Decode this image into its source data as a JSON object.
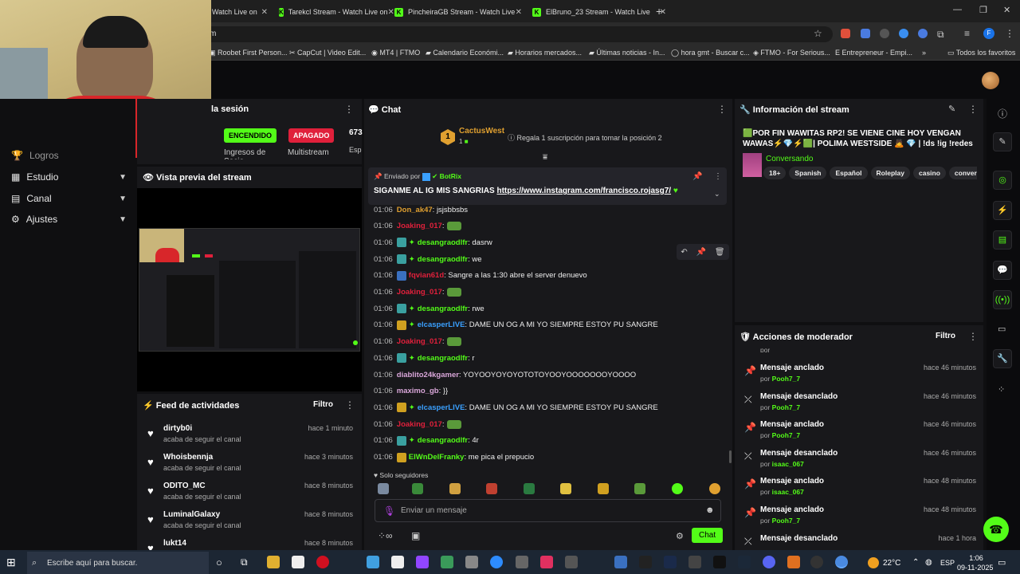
{
  "browser": {
    "tabs": [
      {
        "label": "Watch Live on"
      },
      {
        "label": "Tarekcl Stream - Watch Live on"
      },
      {
        "label": "PincheiraGB Stream - Watch Live"
      },
      {
        "label": "ElBruno_23 Stream - Watch Live"
      }
    ],
    "url": "m",
    "bookmarks": [
      "Roobet First Person...",
      "CapCut | Video Edit...",
      "MT4 | FTMO",
      "Calendario Económi...",
      "Horarios mercados...",
      "Últimas noticias - In...",
      "hora gmt - Buscar c...",
      "FTMO - For Serious...",
      "Entrepreneur - Empi...",
      "Todos los favoritos"
    ]
  },
  "left": {
    "session_title": "la sesión",
    "status_on": "ENCENDIDO",
    "status_off": "APAGADO",
    "count": "673",
    "ingresos_label": "Ingresos de Socio",
    "multistream_label": "Multistream",
    "esp_label": "Esp",
    "nav": {
      "logros": "Logros",
      "estudio": "Estudio",
      "canal": "Canal",
      "ajustes": "Ajustes"
    },
    "preview_title": "Vista previa del stream",
    "feed_title": "Feed de actividades",
    "feed_filter": "Filtro",
    "feed": [
      {
        "name": "dirtyb0i",
        "sub": "acaba de seguir el canal",
        "time": "hace 1 minuto"
      },
      {
        "name": "Whoisbennja",
        "sub": "acaba de seguir el canal",
        "time": "hace 3 minutos"
      },
      {
        "name": "ODITO_MC",
        "sub": "acaba de seguir el canal",
        "time": "hace 8 minutos"
      },
      {
        "name": "LuminalGalaxy",
        "sub": "acaba de seguir el canal",
        "time": "hace 8 minutos"
      },
      {
        "name": "lukt14",
        "sub": "",
        "time": "hace 8 minutos"
      }
    ]
  },
  "chat": {
    "title": "Chat",
    "top_user": "CactusWest",
    "top_rank": "1",
    "top_count": "1",
    "gift_prompt": "Regala 1 suscripción para tomar la posición 2",
    "pinned_by_label": "Enviado por",
    "pinned_by": "BotRix",
    "pinned_text": "SIGANME AL IG MIS SANGRIAS ",
    "pinned_link": "https://www.instagram.com/francisco.rojasg7/",
    "messages": [
      {
        "time": "01:06",
        "user": "Don_ak47",
        "color": "#e0a030",
        "text": ": jsjsbbsbs"
      },
      {
        "time": "01:06",
        "user": "Joaking_017",
        "color": "#e0203b",
        "text": ":"
      },
      {
        "time": "01:06",
        "user": "desangraodlfr",
        "color": "#53fc18",
        "text": ": dasrw"
      },
      {
        "time": "01:06",
        "user": "desangraodlfr",
        "color": "#53fc18",
        "text": ": we"
      },
      {
        "time": "01:06",
        "user": "fqvian61d",
        "color": "#e0203b",
        "text": ": Sangre a las 1:30 abre el server denuevo"
      },
      {
        "time": "01:06",
        "user": "Joaking_017",
        "color": "#e0203b",
        "text": ":"
      },
      {
        "time": "01:06",
        "user": "desangraodlfr",
        "color": "#53fc18",
        "text": ": rwe"
      },
      {
        "time": "01:06",
        "user": "elcasperLIVE",
        "color": "#3aa0ff",
        "text": ": DAME UN OG A MI YO SIEMPRE ESTOY PU SANGRE"
      },
      {
        "time": "01:06",
        "user": "Joaking_017",
        "color": "#e0203b",
        "text": ":"
      },
      {
        "time": "01:06",
        "user": "desangraodlfr",
        "color": "#53fc18",
        "text": ": r"
      },
      {
        "time": "01:06",
        "user": "diablito24kgamer",
        "color": "#d9a6d9",
        "text": ": YOYOOYOYOYOTOTOYOOYOOOOOOOYOOOO"
      },
      {
        "time": "01:06",
        "user": "maximo_gb",
        "color": "#d9a6d9",
        "text": ": }}"
      },
      {
        "time": "01:06",
        "user": "elcasperLIVE",
        "color": "#3aa0ff",
        "text": ": DAME UN OG A MI YO SIEMPRE ESTOY PU SANGRE"
      },
      {
        "time": "01:06",
        "user": "Joaking_017",
        "color": "#e0203b",
        "text": ":"
      },
      {
        "time": "01:06",
        "user": "desangraodlfr",
        "color": "#53fc18",
        "text": ": 4r"
      },
      {
        "time": "01:06",
        "user": "ElWnDelFranky",
        "color": "#53fc18",
        "text": ": me pica el prepucio"
      }
    ],
    "followers_only": "Solo seguidores",
    "input_placeholder": "Enviar un mensaje",
    "send_label": "Chat"
  },
  "stream_info": {
    "title": "Información del stream",
    "stream_title": "🟩POR FIN WAWITAS RP2! SE VIENE CINE HOY VENGAN WAWAS⚡💎⚡🟩| POLIMA WESTSIDE 🙇 💎 | !ds !ig !redes",
    "category": "Conversando",
    "tags": [
      "18+",
      "Spanish",
      "Español",
      "Roleplay",
      "casino",
      "conversand"
    ]
  },
  "mod": {
    "title": "Acciones de moderador",
    "filter": "Filtro",
    "actions": [
      {
        "action": "Mensaje anclado",
        "by": "Pooh7_7",
        "time": "hace 46 minutos"
      },
      {
        "action": "Mensaje desanclado",
        "by": "Pooh7_7",
        "time": "hace 46 minutos"
      },
      {
        "action": "Mensaje anclado",
        "by": "Pooh7_7",
        "time": "hace 46 minutos"
      },
      {
        "action": "Mensaje desanclado",
        "by": "isaac_067",
        "time": "hace 46 minutos"
      },
      {
        "action": "Mensaje anclado",
        "by": "isaac_067",
        "time": "hace 48 minutos"
      },
      {
        "action": "Mensaje anclado",
        "by": "Pooh7_7",
        "time": "hace 48 minutos"
      },
      {
        "action": "Mensaje desanclado",
        "by": "",
        "time": "hace 1 hora"
      }
    ],
    "by_prefix": "por "
  },
  "taskbar": {
    "search": "Escribe aquí para buscar.",
    "temp": "22°C",
    "lang": "ESP",
    "time": "1:06",
    "date": "09-11-2025"
  }
}
